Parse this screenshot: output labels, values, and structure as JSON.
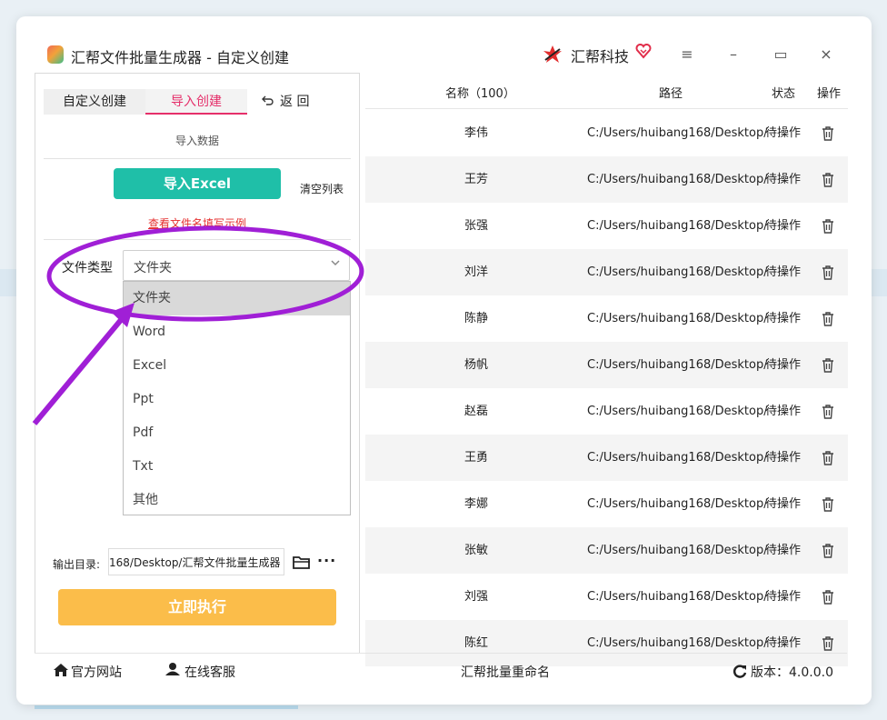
{
  "app": {
    "title": "汇帮文件批量生成器 - 自定义创建",
    "brand": "汇帮科技"
  },
  "window_controls": {
    "menu": "≡",
    "minimize": "–",
    "maximize": "▭",
    "close": "×"
  },
  "tabs": [
    {
      "label": "自定义创建",
      "active": false
    },
    {
      "label": "导入创建",
      "active": true
    }
  ],
  "back_label": "返 回",
  "section_label": "导入数据",
  "import_button": "导入Excel",
  "clear_button": "清空列表",
  "example_link": "查看文件名填写示例",
  "file_type": {
    "label": "文件类型",
    "selected": "文件夹",
    "options": [
      "文件夹",
      "Word",
      "Excel",
      "Ppt",
      "Pdf",
      "Txt",
      "其他"
    ]
  },
  "output": {
    "label": "输出目录:",
    "value": "168/Desktop/汇帮文件批量生成器"
  },
  "run_button": "立即执行",
  "table": {
    "headers": {
      "name": "名称（100）",
      "path": "路径",
      "status": "状态",
      "action": "操作"
    },
    "rows": [
      {
        "name": "李伟",
        "path": "C:/Users/huibang168/Desktop/",
        "status": "待操作"
      },
      {
        "name": "王芳",
        "path": "C:/Users/huibang168/Desktop/",
        "status": "待操作"
      },
      {
        "name": "张强",
        "path": "C:/Users/huibang168/Desktop/",
        "status": "待操作"
      },
      {
        "name": "刘洋",
        "path": "C:/Users/huibang168/Desktop/",
        "status": "待操作"
      },
      {
        "name": "陈静",
        "path": "C:/Users/huibang168/Desktop/",
        "status": "待操作"
      },
      {
        "name": "杨帆",
        "path": "C:/Users/huibang168/Desktop/",
        "status": "待操作"
      },
      {
        "name": "赵磊",
        "path": "C:/Users/huibang168/Desktop/",
        "status": "待操作"
      },
      {
        "name": "王勇",
        "path": "C:/Users/huibang168/Desktop/",
        "status": "待操作"
      },
      {
        "name": "李娜",
        "path": "C:/Users/huibang168/Desktop/",
        "status": "待操作"
      },
      {
        "name": "张敏",
        "path": "C:/Users/huibang168/Desktop/",
        "status": "待操作"
      },
      {
        "name": "刘强",
        "path": "C:/Users/huibang168/Desktop/",
        "status": "待操作"
      },
      {
        "name": "陈红",
        "path": "C:/Users/huibang168/Desktop/",
        "status": "待操作"
      }
    ]
  },
  "footer": {
    "website": "官方网站",
    "support": "在线客服",
    "center": "汇帮批量重命名",
    "version": "版本：4.0.0.0"
  },
  "colors": {
    "accent_pink": "#e52f6a",
    "import_green": "#1fbfa8",
    "run_orange": "#fbbd4a",
    "annotation_purple": "#a01fd6",
    "link_red": "#e52f2f"
  },
  "icons": [
    "app-icon",
    "brand-logo-icon",
    "heart-icon",
    "menu-icon",
    "minimize-icon",
    "maximize-icon",
    "close-icon",
    "back-arrow-icon",
    "chevron-down-icon",
    "folder-icon",
    "more-icon",
    "trash-icon",
    "home-icon",
    "user-icon",
    "refresh-icon"
  ]
}
